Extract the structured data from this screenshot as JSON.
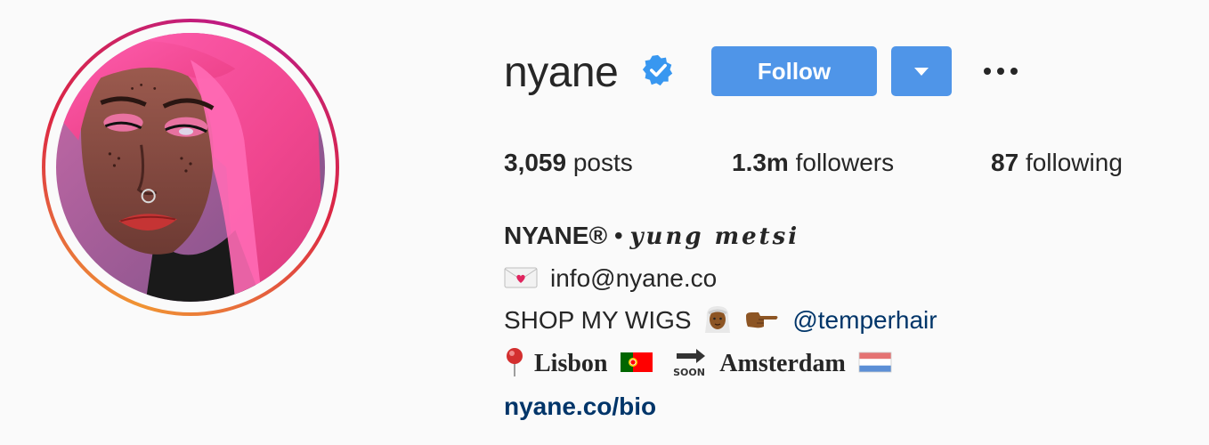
{
  "profile": {
    "username": "nyane",
    "verified_icon": "verified-badge-icon",
    "follow_label": "Follow",
    "dropdown_icon": "caret-down-icon",
    "more_icon": "more-options-icon",
    "colors": {
      "follow_button": "#4f95e8",
      "link": "#003569",
      "verified": "#3897f0"
    }
  },
  "stats": {
    "posts_count": "3,059",
    "posts_label": "posts",
    "followers_count": "1.3m",
    "followers_label": "followers",
    "following_count": "87",
    "following_label": "following"
  },
  "bio": {
    "full_name": "NYANE®",
    "separator": "•",
    "script_name": "yung metsi",
    "email": "info@nyane.co",
    "shop_text": "SHOP MY WIGS",
    "mention": "@temperhair",
    "location_from": "Lisbon",
    "soon_label": "SOON",
    "location_to": "Amsterdam",
    "link": "nyane.co/bio"
  }
}
